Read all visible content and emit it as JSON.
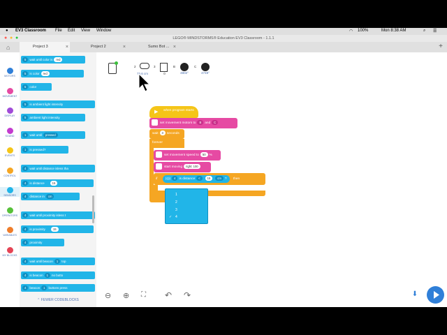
{
  "menubar": {
    "app": "EV3 Classroom",
    "items": [
      "File",
      "Edit",
      "View",
      "Window"
    ],
    "battery": "100%",
    "clock": "Mon 8:38 AM"
  },
  "window_title": "LEGO® MINDSTORMS® Education EV3 Classroom - 1.1.1",
  "tabs": [
    {
      "label": "Project 3"
    },
    {
      "label": "Project 2"
    },
    {
      "label": "Sumo Bot ..."
    }
  ],
  "categories": [
    {
      "label": "MOTORS",
      "color": "#2f7fd8"
    },
    {
      "label": "MOVEMENT",
      "color": "#e64aa3"
    },
    {
      "label": "DISPLAY",
      "color": "#a04bd8"
    },
    {
      "label": "SOUND",
      "color": "#c33bcf"
    },
    {
      "label": "EVENTS",
      "color": "#f5c518"
    },
    {
      "label": "CONTROL",
      "color": "#f5a623"
    },
    {
      "label": "SENSORS",
      "color": "#21b5e8"
    },
    {
      "label": "OPERATORS",
      "color": "#57c13a"
    },
    {
      "label": "VARIABLES",
      "color": "#ef7d2a"
    },
    {
      "label": "MY BLOCKS",
      "color": "#e54455"
    }
  ],
  "palette": {
    "b1": {
      "port": "5",
      "text": "wait until color is",
      "val": "red"
    },
    "b2": {
      "port": "5",
      "text": "is color",
      "val": "red"
    },
    "b3": {
      "port": "5",
      "text": "color"
    },
    "b4": {
      "port": "5",
      "text": "is ambient light intensity"
    },
    "b5": {
      "port": "5",
      "text": "ambient light intensity"
    },
    "b6": {
      "port": "1",
      "text": "wait until",
      "val": "pressed"
    },
    "b7": {
      "port": "1",
      "text": "is pressed?"
    },
    "b8": {
      "port": "4",
      "text": "wait until distance is",
      "tail": "less tha"
    },
    "b9": {
      "port": "4",
      "text": "is distance",
      "val": "15"
    },
    "b10": {
      "port": "4",
      "text": "distance in",
      "val": "cm"
    },
    "b11": {
      "port": "4",
      "text": "wait until proximity is",
      "tail": "less t"
    },
    "b12": {
      "port": "4",
      "text": "is proximity",
      "val": "15"
    },
    "b13": {
      "port": "4",
      "text": "proximity"
    },
    "b14": {
      "port": "4",
      "text": "wait until beacon",
      "val": "1",
      "tail": "top"
    },
    "b15": {
      "port": "4",
      "text": "is beacon",
      "val": "1",
      "tail": "no butto"
    },
    "b16": {
      "port": "4",
      "text": "beacon",
      "val": "1",
      "tail": "buttons press"
    },
    "fewer": "FEWER CODEBLOCKS"
  },
  "ports": [
    {
      "port": "2",
      "value": "76.6 cm"
    },
    {
      "port": "3",
      "value": "0"
    },
    {
      "port": "B",
      "value": "4802°"
    },
    {
      "port": "C",
      "value": "4749°"
    }
  ],
  "program": {
    "start": "when program starts",
    "set_motors": "set movement motors to",
    "motor_b": "B",
    "motor_and": "and",
    "motor_c": "C",
    "wait": "wait",
    "wait_val": "3",
    "wait_unit": "seconds",
    "forever": "forever",
    "speed": "set movement speed to",
    "speed_val": "50",
    "speed_unit": "%",
    "start_moving": "start moving",
    "move_dir": "right: 100",
    "if": "if",
    "if_port": "4",
    "is_distance": "is distance",
    "cmp": "<",
    "dist_val": "15",
    "dist_unit": "cm",
    "q": "?",
    "then": "then"
  },
  "dropdown": {
    "items": [
      "1",
      "2",
      "3",
      "4"
    ],
    "selected": "4"
  }
}
